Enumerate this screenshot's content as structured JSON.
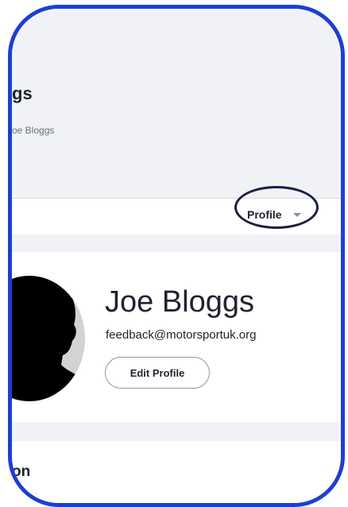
{
  "header": {
    "page_title": "gs",
    "breadcrumb": "oe Bloggs"
  },
  "tabbar": {
    "profile_label": "Profile"
  },
  "profile": {
    "name": "Joe Bloggs",
    "email": "feedback@motorsportuk.org",
    "edit_button": "Edit Profile"
  },
  "section": {
    "title": "on"
  },
  "colors": {
    "frame_border": "#1d3fd1",
    "highlight_ring": "#1d1f45",
    "background": "#f1f2f6",
    "avatar_bg": "#d3d3d3"
  },
  "icons": {
    "avatar": "person-silhouette-icon",
    "dropdown": "caret-down-icon"
  }
}
